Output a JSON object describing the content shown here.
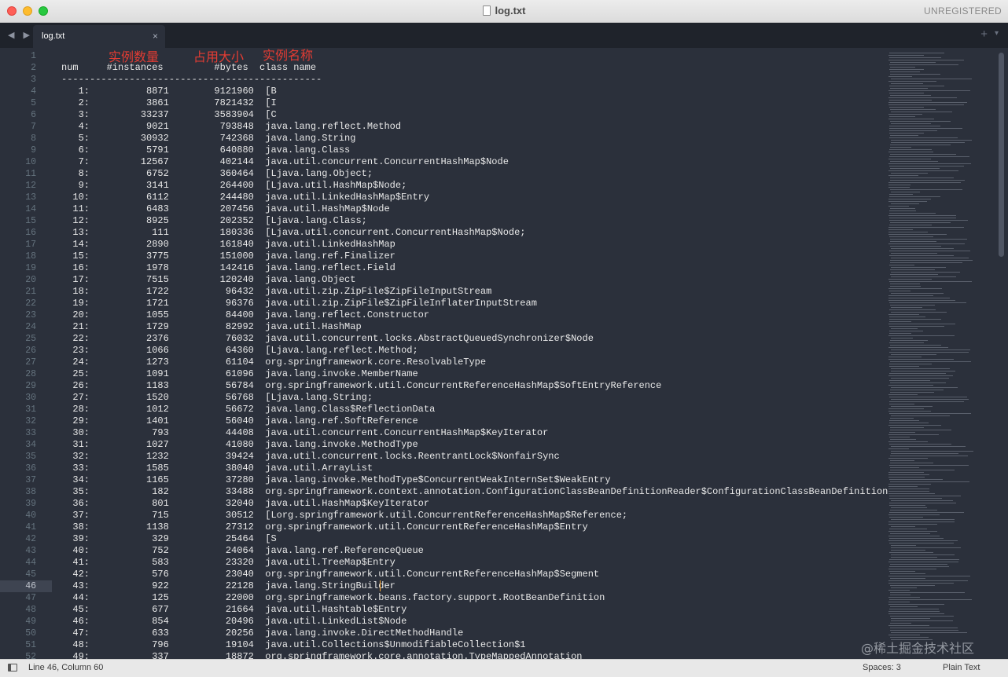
{
  "window": {
    "title": "log.txt",
    "registration": "UNREGISTERED"
  },
  "tabs": [
    {
      "label": "log.txt",
      "close_glyph": "×",
      "active": true
    }
  ],
  "tabbar": {
    "nav_glyph": "◀ ▶",
    "add_glyph": "+",
    "menu_glyph": "▾"
  },
  "annotations": [
    {
      "text": "实例数量"
    },
    {
      "text": "占用大小"
    },
    {
      "text": "实例名称"
    }
  ],
  "editor": {
    "active_line": 46,
    "lines": [
      "",
      "num     #instances         #bytes  class name",
      "----------------------------------------------",
      "   1:          8871        9121960  [B",
      "   2:          3861        7821432  [I",
      "   3:         33237        3583904  [C",
      "   4:          9021         793848  java.lang.reflect.Method",
      "   5:         30932         742368  java.lang.String",
      "   6:          5791         640880  java.lang.Class",
      "   7:         12567         402144  java.util.concurrent.ConcurrentHashMap$Node",
      "   8:          6752         360464  [Ljava.lang.Object;",
      "   9:          3141         264400  [Ljava.util.HashMap$Node;",
      "  10:          6112         244480  java.util.LinkedHashMap$Entry",
      "  11:          6483         207456  java.util.HashMap$Node",
      "  12:          8925         202352  [Ljava.lang.Class;",
      "  13:           111         180336  [Ljava.util.concurrent.ConcurrentHashMap$Node;",
      "  14:          2890         161840  java.util.LinkedHashMap",
      "  15:          3775         151000  java.lang.ref.Finalizer",
      "  16:          1978         142416  java.lang.reflect.Field",
      "  17:          7515         120240  java.lang.Object",
      "  18:          1722          96432  java.util.zip.ZipFile$ZipFileInputStream",
      "  19:          1721          96376  java.util.zip.ZipFile$ZipFileInflaterInputStream",
      "  20:          1055          84400  java.lang.reflect.Constructor",
      "  21:          1729          82992  java.util.HashMap",
      "  22:          2376          76032  java.util.concurrent.locks.AbstractQueuedSynchronizer$Node",
      "  23:          1066          64360  [Ljava.lang.reflect.Method;",
      "  24:          1273          61104  org.springframework.core.ResolvableType",
      "  25:          1091          61096  java.lang.invoke.MemberName",
      "  26:          1183          56784  org.springframework.util.ConcurrentReferenceHashMap$SoftEntryReference",
      "  27:          1520          56768  [Ljava.lang.String;",
      "  28:          1012          56672  java.lang.Class$ReflectionData",
      "  29:          1401          56040  java.lang.ref.SoftReference",
      "  30:           793          44408  java.util.concurrent.ConcurrentHashMap$KeyIterator",
      "  31:          1027          41080  java.lang.invoke.MethodType",
      "  32:          1232          39424  java.util.concurrent.locks.ReentrantLock$NonfairSync",
      "  33:          1585          38040  java.util.ArrayList",
      "  34:          1165          37280  java.lang.invoke.MethodType$ConcurrentWeakInternSet$WeakEntry",
      "  35:           182          33488  org.springframework.context.annotation.ConfigurationClassBeanDefinitionReader$ConfigurationClassBeanDefinition",
      "  36:           801          32040  java.util.HashMap$KeyIterator",
      "  37:           715          30512  [Lorg.springframework.util.ConcurrentReferenceHashMap$Reference;",
      "  38:          1138          27312  org.springframework.util.ConcurrentReferenceHashMap$Entry",
      "  39:           329          25464  [S",
      "  40:           752          24064  java.lang.ref.ReferenceQueue",
      "  41:           583          23320  java.util.TreeMap$Entry",
      "  42:           576          23040  org.springframework.util.ConcurrentReferenceHashMap$Segment",
      "  43:           922          22128  java.lang.StringBuilder",
      "  44:           125          22000  org.springframework.beans.factory.support.RootBeanDefinition",
      "  45:           677          21664  java.util.Hashtable$Entry",
      "  46:           854          20496  java.util.LinkedList$Node",
      "  47:           633          20256  java.lang.invoke.DirectMethodHandle",
      "  48:           796          19104  java.util.Collections$UnmodifiableCollection$1",
      "  49:           337          18872  org.springframework.core.annotation.TypeMappedAnnotation"
    ]
  },
  "status": {
    "position": "Line 46, Column 60",
    "indent": "Spaces: 3",
    "syntax": "Plain Text"
  },
  "watermark": "@稀土掘金技术社区",
  "colors": {
    "editor_bg": "#2b303b",
    "gutter_text": "#65737e",
    "code_text": "#e8e8e8",
    "annotation_red": "#e33c33",
    "cursor": "#f0a030"
  }
}
